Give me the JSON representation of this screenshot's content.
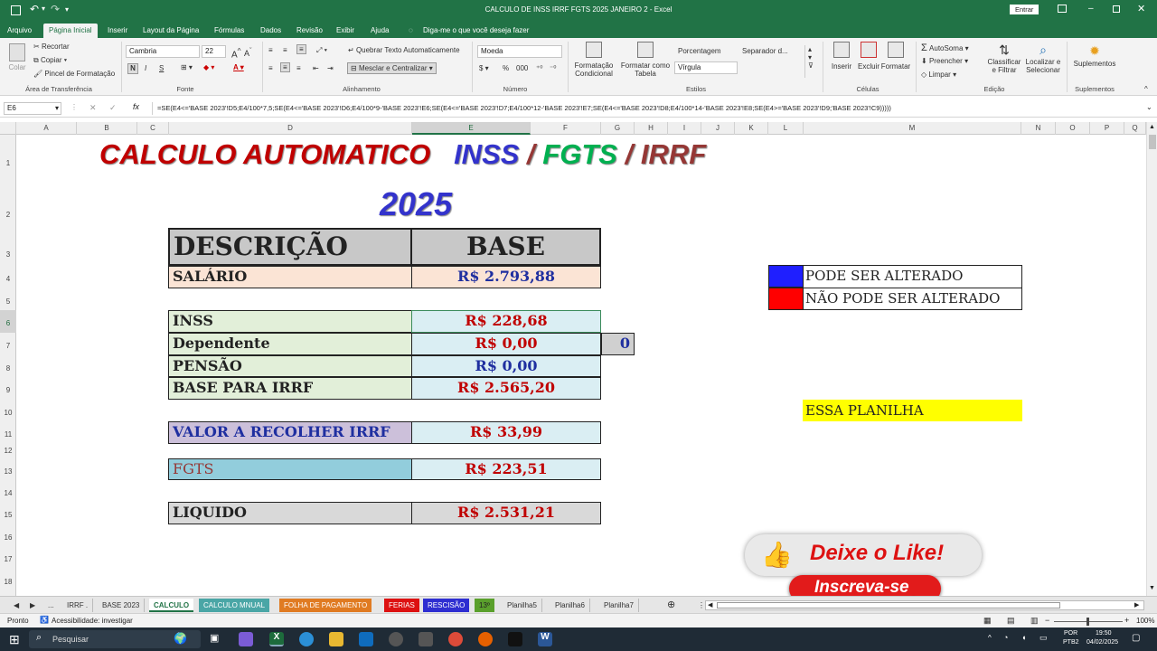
{
  "window": {
    "title": "CALCULO DE INSS IRRF FGTS 2025 JANEIRO 2  -  Excel",
    "signin": "Entrar"
  },
  "ribbon_tabs": [
    "Arquivo",
    "Página Inicial",
    "Inserir",
    "Layout da Página",
    "Fórmulas",
    "Dados",
    "Revisão",
    "Exibir",
    "Ajuda"
  ],
  "tell_me": "Diga-me o que você deseja fazer",
  "ribbon": {
    "clipboard": {
      "paste": "Colar",
      "cut": "Recortar",
      "copy": "Copiar",
      "format_painter": "Pincel de Formatação",
      "label": "Área de Transferência"
    },
    "font": {
      "name": "Cambria",
      "size": "22",
      "label": "Fonte",
      "bold": "N",
      "italic": "I",
      "underline": "S"
    },
    "alignment": {
      "wrap": "Quebrar Texto Automaticamente",
      "merge": "Mesclar e Centralizar",
      "label": "Alinhamento"
    },
    "number": {
      "format": "Moeda",
      "label": "Número"
    },
    "styles": {
      "conditional": "Formatação Condicional",
      "as_table": "Formatar como Tabela",
      "style1": "Porcentagem",
      "style2": "Separador d...",
      "style3": "Vírgula",
      "label": "Estilos"
    },
    "cells": {
      "insert": "Inserir",
      "delete": "Excluir",
      "format": "Formatar",
      "label": "Células"
    },
    "editing": {
      "autosum": "AutoSoma",
      "fill": "Preencher",
      "clear": "Limpar",
      "sort": "Classificar e Filtrar",
      "find": "Localizar e Selecionar",
      "label": "Edição"
    },
    "addins": {
      "label": "Suplementos",
      "btn": "Suplementos"
    }
  },
  "formula_bar": {
    "name_box": "E6",
    "formula": "=SE(E4<='BASE 2023'!D5;E4/100*7,5;SE(E4<='BASE 2023'!D6;E4/100*9-'BASE 2023'!E6;SE(E4<='BASE 2023'!D7;E4/100*12-'BASE 2023'!E7;SE(E4<='BASE 2023'!D8;E4/100*14-'BASE 2023'!E8;SE(E4>='BASE 2023'!D9;'BASE 2023'!C9)))))"
  },
  "columns": [
    "A",
    "B",
    "C",
    "D",
    "E",
    "F",
    "G",
    "H",
    "I",
    "J",
    "K",
    "L",
    "M",
    "N",
    "O",
    "P",
    "Q"
  ],
  "rows": [
    "1",
    "2",
    "3",
    "4",
    "5",
    "6",
    "7",
    "8",
    "9",
    "10",
    "11",
    "12",
    "13",
    "14",
    "15",
    "16",
    "17",
    "18"
  ],
  "sheet": {
    "title_part1": "CALCULO AUTOMATICO",
    "title_inss": "INSS",
    "slash1": "/",
    "title_fgts": "FGTS",
    "slash2": "/",
    "title_irrf": "IRRF",
    "year": "2025",
    "header_desc": "DESCRIÇÃO",
    "header_base": "BASE",
    "salario_label": "SALÁRIO",
    "salario_value": "R$ 2.793,88",
    "inss_label": "INSS",
    "inss_value": "R$ 228,68",
    "dependente_label": "Dependente",
    "dependente_value": "R$ 0,00",
    "dependente_count": "0",
    "pensao_label": "PENSÃO",
    "pensao_value": "R$ 0,00",
    "base_irrf_label": "BASE PARA IRRF",
    "base_irrf_value": "R$ 2.565,20",
    "irrf_label": "VALOR A RECOLHER IRRF",
    "irrf_value": "R$ 33,99",
    "fgts_label": "FGTS",
    "fgts_value": "R$ 223,51",
    "liquido_label": "LIQUIDO",
    "liquido_value": "R$ 2.531,21",
    "legend_blue": "PODE SER ALTERADO",
    "legend_red": "NÃO PODE SER ALTERADO",
    "note": "ESSA PLANILHA"
  },
  "overlay": {
    "like": "Deixe o Like!",
    "subscribe": "Inscreva-se"
  },
  "sheet_tabs": [
    "...",
    "IRRF .",
    "BASE 2023",
    "CALCULO",
    "CALCULO MNUAL",
    "FOLHA DE PAGAMENTO",
    "FERIAS",
    "RESCISÃO",
    "13º",
    "Planilha5",
    "Planilha6",
    "Planilha7"
  ],
  "status": {
    "ready": "Pronto",
    "accessibility": "Acessibilidade: investigar",
    "zoom": "100%"
  },
  "taskbar": {
    "search": "Pesquisar",
    "lang1": "POR",
    "lang2": "PTB2",
    "time": "19:50",
    "date": "04/02/2025"
  },
  "colors": {
    "excel_green": "#217346",
    "title_red": "#c00000",
    "title_blue": "#3333cc",
    "title_green": "#00b050",
    "title_brown": "#953735",
    "value_red": "#c00000",
    "value_blue": "#1f2fa0"
  }
}
